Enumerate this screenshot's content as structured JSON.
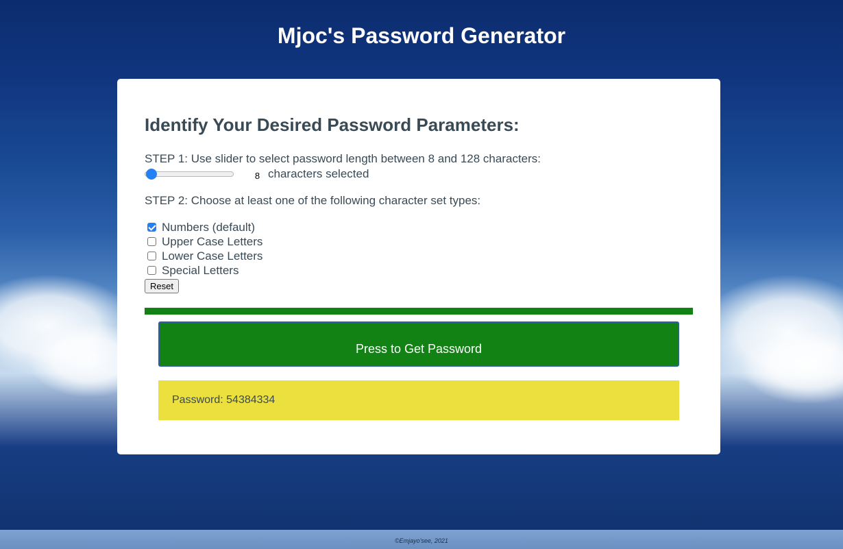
{
  "header": {
    "title": "Mjoc's Password Generator"
  },
  "form": {
    "heading": "Identify Your Desired Password Parameters:",
    "step1": {
      "text": "STEP 1: Use slider to select password length between 8 and 128 characters:",
      "slider_min": 8,
      "slider_max": 128,
      "slider_value": "8",
      "value_suffix": "characters selected"
    },
    "step2": {
      "text": "STEP 2: Choose at least one of the following character set types:",
      "options": [
        {
          "label": "Numbers (default)",
          "checked": true
        },
        {
          "label": "Upper Case Letters",
          "checked": false
        },
        {
          "label": "Lower Case Letters",
          "checked": false
        },
        {
          "label": "Special Letters",
          "checked": false
        }
      ]
    },
    "reset_label": "Reset",
    "generate_label": "Press to Get Password",
    "password_text": "Password: 54384334"
  },
  "colors": {
    "accent_green": "#128214",
    "password_background": "#ece03f",
    "slider_blue": "#2680f4"
  },
  "footer": {
    "text": "©Emjayo'see, 2021"
  }
}
